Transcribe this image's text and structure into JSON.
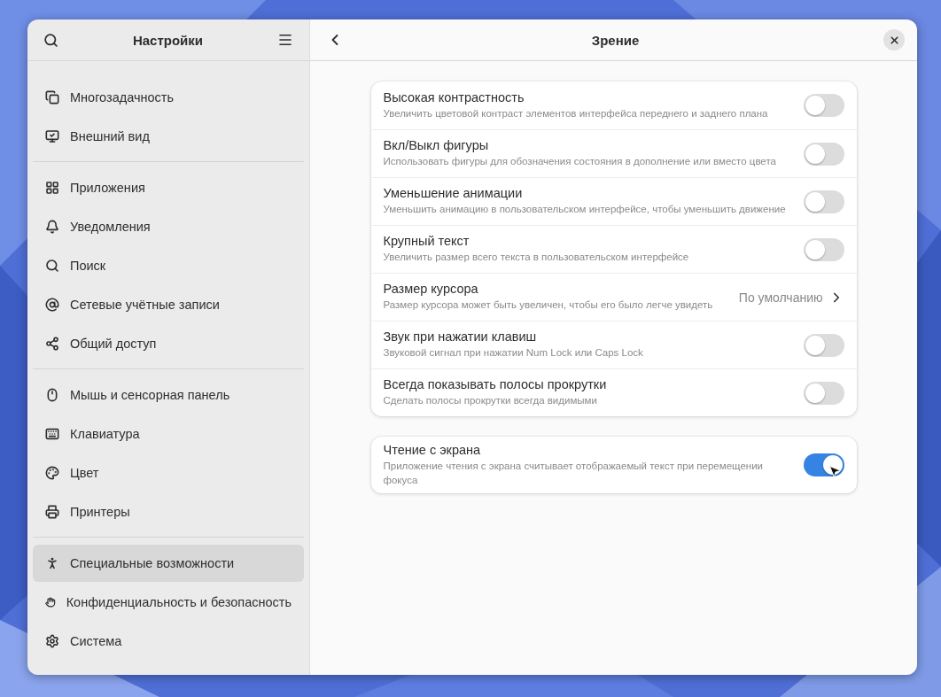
{
  "sidebar": {
    "title": "Настройки",
    "groups": [
      {
        "items": [
          {
            "label": "Многозадачность",
            "selected": false
          },
          {
            "label": "Внешний вид",
            "selected": false
          }
        ]
      },
      {
        "items": [
          {
            "label": "Приложения",
            "selected": false
          },
          {
            "label": "Уведомления",
            "selected": false
          },
          {
            "label": "Поиск",
            "selected": false
          },
          {
            "label": "Сетевые учётные записи",
            "selected": false
          },
          {
            "label": "Общий доступ",
            "selected": false
          }
        ]
      },
      {
        "items": [
          {
            "label": "Мышь и сенсорная панель",
            "selected": false
          },
          {
            "label": "Клавиатура",
            "selected": false
          },
          {
            "label": "Цвет",
            "selected": false
          },
          {
            "label": "Принтеры",
            "selected": false
          }
        ]
      },
      {
        "items": [
          {
            "label": "Специальные возможности",
            "selected": true
          },
          {
            "label": "Конфиденциальность и безопасность",
            "selected": false
          },
          {
            "label": "Система",
            "selected": false
          }
        ]
      }
    ]
  },
  "page": {
    "title": "Зрение",
    "groups": [
      {
        "rows": [
          {
            "kind": "toggle",
            "title": "Высокая контрастность",
            "subtitle": "Увеличить цветовой контраст элементов интерфейса переднего и заднего плана",
            "on": false
          },
          {
            "kind": "toggle",
            "title": "Вкл/Выкл фигуры",
            "subtitle": "Использовать фигуры для обозначения состояния в дополнение или вместо цвета",
            "on": false
          },
          {
            "kind": "toggle",
            "title": "Уменьшение анимации",
            "subtitle": "Уменьшить анимацию в пользовательском интерфейсе, чтобы уменьшить движение",
            "on": false
          },
          {
            "kind": "toggle",
            "title": "Крупный текст",
            "subtitle": "Увеличить размер всего текста в пользовательском интерфейсе",
            "on": false
          },
          {
            "kind": "link",
            "title": "Размер курсора",
            "subtitle": "Размер курсора может быть увеличен, чтобы его было легче увидеть",
            "value": "По умолчанию"
          },
          {
            "kind": "toggle",
            "title": "Звук при нажатии клавиш",
            "subtitle": "Звуковой сигнал при нажатии Num Lock или Caps Lock",
            "on": false
          },
          {
            "kind": "toggle",
            "title": "Всегда показывать полосы прокрутки",
            "subtitle": "Сделать полосы прокрутки всегда видимыми",
            "on": false
          }
        ]
      },
      {
        "rows": [
          {
            "kind": "toggle",
            "title": "Чтение с экрана",
            "subtitle": "Приложение чтения с экрана считывает отображаемый текст при перемещении фокуса",
            "on": true
          }
        ]
      }
    ]
  }
}
